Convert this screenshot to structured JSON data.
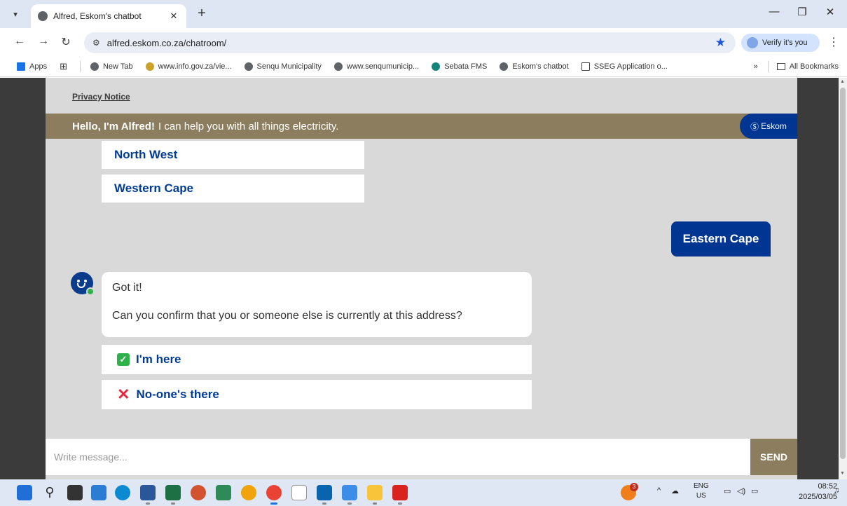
{
  "browser": {
    "tab_title": "Alfred, Eskom's chatbot",
    "url": "alfred.eskom.co.za/chatroom/",
    "verify_label": "Verify it's you",
    "bookmarks": [
      "Apps",
      "New Tab",
      "www.info.gov.za/vie...",
      "Senqu Municipality",
      "www.senqumunicip...",
      "Sebata FMS",
      "Eskom's chatbot",
      "SSEG Application o..."
    ],
    "all_bookmarks": "All Bookmarks"
  },
  "chat": {
    "privacy_label": "Privacy Notice",
    "header_bold": "Hello, I'm Alfred!",
    "header_text": "I can help you with all things electricity.",
    "brand": "Eskom",
    "province_options": [
      "North West",
      "Western Cape"
    ],
    "user_reply": "Eastern Cape",
    "bot_lines": [
      "Got it!",
      "Can you confirm that you or someone else is currently at this address?"
    ],
    "choices": [
      "I'm here",
      "No-one's there"
    ],
    "input_placeholder": "Write message...",
    "send_label": "SEND"
  },
  "taskbar": {
    "lang": "ENG",
    "region": "US",
    "time": "08:52",
    "date": "2025/03/05",
    "badge_count": "3"
  },
  "colors": {
    "eskom_blue": "#003592",
    "header_brown": "#8c7d5e",
    "check_green": "#2db24b",
    "x_red": "#e8283b"
  }
}
